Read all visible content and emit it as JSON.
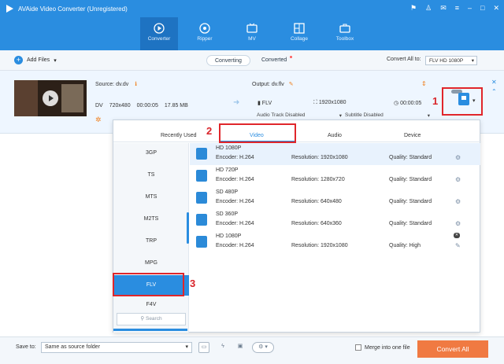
{
  "app": {
    "title": "AVAide Video Converter (Unregistered)"
  },
  "toolbar": {
    "items": [
      {
        "label": "Converter",
        "icon": "convert-icon"
      },
      {
        "label": "Ripper",
        "icon": "disc-icon"
      },
      {
        "label": "MV",
        "icon": "tv-icon"
      },
      {
        "label": "Collage",
        "icon": "grid-icon"
      },
      {
        "label": "Toolbox",
        "icon": "toolbox-icon"
      }
    ]
  },
  "subbar": {
    "add_files": "Add Files",
    "tab_converting": "Converting",
    "tab_converted": "Converted",
    "convert_all_to_label": "Convert All to:",
    "convert_all_to_value": "FLV HD 1080P"
  },
  "file": {
    "source": "Source: dv.dv",
    "format": "DV",
    "resolution": "720x480",
    "duration": "00:00:05",
    "size": "17.85 MB",
    "output": "Output: dv.flv",
    "out_format": "FLV",
    "out_resolution": "1920x1080",
    "out_duration": "00:00:05",
    "audio_track": "Audio Track Disabled",
    "subtitle": "Subtitle Disabled"
  },
  "annotations": {
    "n1": "1",
    "n2": "2",
    "n3": "3"
  },
  "panel": {
    "tabs": [
      "Recently Used",
      "Video",
      "Audio",
      "Device"
    ],
    "formats": [
      "3GP",
      "TS",
      "MTS",
      "M2TS",
      "TRP",
      "MPG",
      "FLV",
      "F4V"
    ],
    "search_placeholder": "Search",
    "presets": [
      {
        "name": "HD 1080P",
        "encoder": "Encoder: H.264",
        "resolution": "Resolution: 1920x1080",
        "quality": "Quality: Standard"
      },
      {
        "name": "HD 720P",
        "encoder": "Encoder: H.264",
        "resolution": "Resolution: 1280x720",
        "quality": "Quality: Standard"
      },
      {
        "name": "SD 480P",
        "encoder": "Encoder: H.264",
        "resolution": "Resolution: 640x480",
        "quality": "Quality: Standard"
      },
      {
        "name": "SD 360P",
        "encoder": "Encoder: H.264",
        "resolution": "Resolution: 640x360",
        "quality": "Quality: Standard"
      },
      {
        "name": "HD 1080P",
        "encoder": "Encoder: H.264",
        "resolution": "Resolution: 1920x1080",
        "quality": "Quality: High"
      }
    ]
  },
  "footer": {
    "save_to": "Save to:",
    "path": "Same as source folder",
    "merge": "Merge into one file",
    "convert_all": "Convert All"
  },
  "colors": {
    "accent": "#2a8de0",
    "annotation": "#e0262b",
    "convert": "#f07a42"
  }
}
